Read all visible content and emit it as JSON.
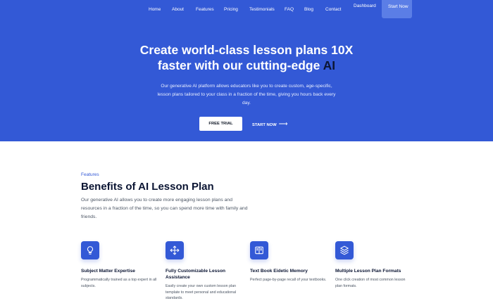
{
  "nav": {
    "links": [
      "Home",
      "About",
      "Features",
      "Pricing",
      "Testimonials",
      "FAQ",
      "Blog",
      "Contact",
      "Dashboard"
    ],
    "cta": "Start Now"
  },
  "hero": {
    "title_line1": "Create world-class lesson plans 10X",
    "title_line2": "faster with our cutting-edge",
    "title_highlight": "AI",
    "subtitle": "Our generative AI platform allows educators like you to create custom, age-specific, lesson plans tailored to your class in a fraction of the time, giving you hours back every day.",
    "primary_button": "FREE TRIAL",
    "secondary_button": "START NOW",
    "secondary_arrow": "⟶"
  },
  "features_section": {
    "eyebrow": "Features",
    "title": "Benefits of AI Lesson Plan",
    "description": "Our generative AI allows you to create more engaging lesson plans and resources in a fraction of the time, so you can spend more time with family and friends.",
    "items": [
      {
        "icon": "lightbulb-icon",
        "title": "Subject Matter Expertise",
        "description": "Programmatically trained as a top expert in all subjects."
      },
      {
        "icon": "move-arrows-icon",
        "title": "Fully Customizable Lesson Assistance",
        "description": "Easily create your own custom lesson plan template to meet personal and educational standards."
      },
      {
        "icon": "open-book-icon",
        "title": "Text Book Eidetic Memory",
        "description": "Perfect page-by-page recall of your textbooks."
      },
      {
        "icon": "layers-icon",
        "title": "Multiple Lesson Plan Formats",
        "description": "One click creation of most common lesson plan formats."
      }
    ]
  },
  "colors": {
    "brand": "#3359d6",
    "dark": "#0b1533",
    "white": "#ffffff"
  }
}
